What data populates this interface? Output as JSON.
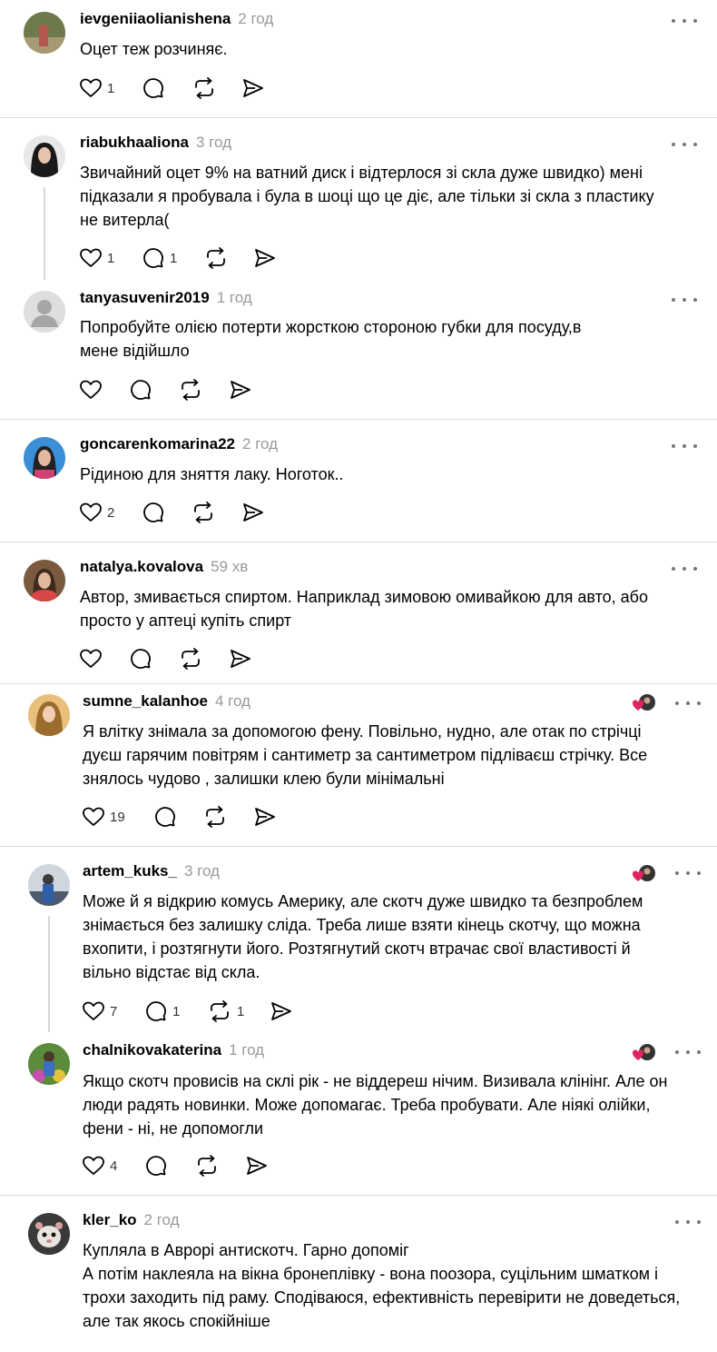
{
  "comments": [
    {
      "username": "ievgeniiaolianishena",
      "time": "2 год",
      "lines": [
        "Оцет теж розчиняє."
      ],
      "likes": "1",
      "replies": "",
      "reposts": ""
    },
    {
      "username": "riabukhaaliona",
      "time": "3 год",
      "lines": [
        "Звичайний оцет 9% на ватний диск і відтерлося зі скла дуже швидко) мені",
        "підказали я пробувала і була в шоці що це діє, але тільки зі скла з пластику",
        "не витерла("
      ],
      "likes": "1",
      "replies": "1",
      "reposts": ""
    },
    {
      "username": "tanyasuvenir2019",
      "time": "1 год",
      "lines": [
        "Попробуйте олією потерти жорсткою стороною губки для посуду,в",
        "мене відійшло"
      ],
      "likes": "",
      "replies": "",
      "reposts": ""
    },
    {
      "username": "goncarenkomarina22",
      "time": "2 год",
      "lines": [
        "Рідиною для зняття лаку. Ноготок.."
      ],
      "likes": "2",
      "replies": "",
      "reposts": ""
    },
    {
      "username": "natalya.kovalova",
      "time": "59 хв",
      "lines": [
        "Автор, змивається спиртом. Наприклад зимовою омивайкою для авто, або",
        "просто у аптеці купіть спирт"
      ],
      "likes": "",
      "replies": "",
      "reposts": ""
    },
    {
      "username": "sumne_kalanhoe",
      "time": "4 год",
      "lines": [
        "Я влітку знімала за допомогою фену. Повільно, нудно, але отак по стрічці",
        "дуєш гарячим повітрям і сантиметр за сантиметром підліваєш стрічку. Все",
        "знялось чудово , залишки клею були мінімальні"
      ],
      "likes": "19",
      "replies": "",
      "reposts": ""
    },
    {
      "username": "artem_kuks_",
      "time": "3 год",
      "lines": [
        "Може й я відкрию комусь Америку, але скотч дуже швидко та безпроблем",
        "знімається без залишку сліда. Треба лише взяти кінець скотчу, що можна",
        "вхопити, і розтягнути його. Розтягнутий скотч втрачає свої властивості й",
        "вільно відстає від скла."
      ],
      "likes": "7",
      "replies": "1",
      "reposts": "1"
    },
    {
      "username": "chalnikovakaterina",
      "time": "1 год",
      "lines": [
        "Якщо скотч провисів на склі рік - не віддереш нічим. Визивала клінінг. Але он",
        "люди радять новинки. Може допомагає. Треба пробувати. Але ніякі олійки,",
        "фени - ні, не допомогли"
      ],
      "likes": "4",
      "replies": "",
      "reposts": ""
    },
    {
      "username": "kler_ko",
      "time": "2 год",
      "lines": [
        "Купляла в Аврорі антискотч. Гарно допоміг",
        "А потім наклеяла на вікна бронеплівку - вона поозора, суцільним шматком і",
        "трохи заходить під раму. Сподіваюся, ефективність перевірити не доведеться,",
        "але так якось спокійніше"
      ],
      "likes": "",
      "replies": "",
      "reposts": ""
    }
  ],
  "icons": {
    "like": "heart-icon",
    "reply": "comment-icon",
    "repost": "repost-icon",
    "share": "share-icon",
    "more": "more-dots-icon",
    "liked_by_author": "liked-by-author-icon"
  },
  "colors": {
    "username": "#000000",
    "time": "#999999",
    "icon": "#000000",
    "divider": "#dcdcdc",
    "heart_badge": "#e0245e"
  }
}
